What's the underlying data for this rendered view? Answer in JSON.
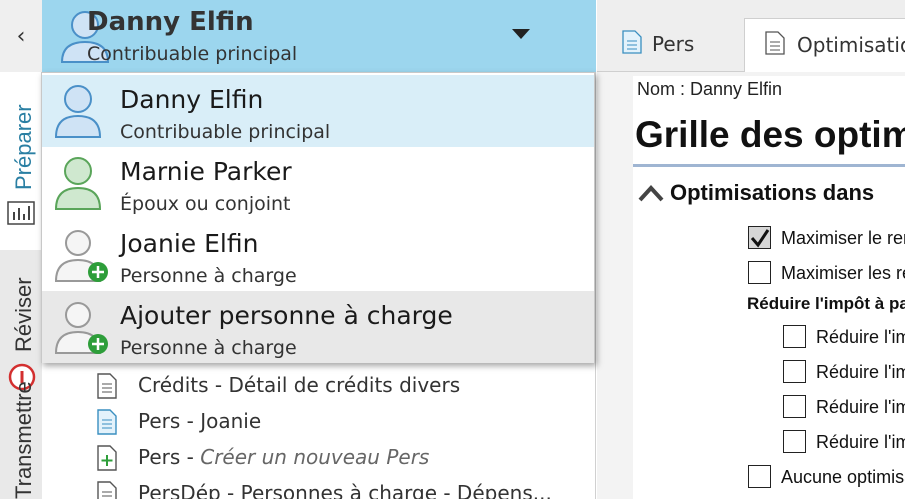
{
  "rail": {
    "collapse_glyph": "‹",
    "tabs": [
      {
        "label": "Préparer",
        "icon": "chart-icon"
      },
      {
        "label": "Réviser",
        "icon": "error-icon"
      },
      {
        "label": "Transmettre"
      }
    ]
  },
  "header": {
    "name": "Danny Elfin",
    "role": "Contribuable principal",
    "icon": "chevron-down-icon"
  },
  "dropdown": {
    "items": [
      {
        "name": "Danny Elfin",
        "role": "Contribuable principal",
        "icon": "person-blue-icon"
      },
      {
        "name": "Marnie Parker",
        "role": "Époux ou conjoint",
        "icon": "person-green-icon"
      },
      {
        "name": "Joanie Elfin",
        "role": "Personne à charge",
        "icon": "person-add-icon"
      },
      {
        "name": "Ajouter personne à charge",
        "role": "Personne à charge",
        "icon": "person-add-icon"
      }
    ]
  },
  "files": [
    {
      "prefix": "Crédits - Détail de crédits divers",
      "suffix": "",
      "icon": "document-icon"
    },
    {
      "prefix": "Pers - Joanie",
      "suffix": "",
      "icon": "document-blue-icon"
    },
    {
      "prefix": "Pers - ",
      "suffix": "Créer un nouveau Pers",
      "icon": "document-add-icon"
    },
    {
      "prefix": "PersDép - Personnes à charge - Dépens...",
      "suffix": "",
      "icon": "document-icon"
    }
  ],
  "tabs": [
    {
      "label": "Pers",
      "icon": "document-blue-icon"
    },
    {
      "label": "Optimisation",
      "icon": "document-icon"
    }
  ],
  "form": {
    "nom": "Nom : Danny Elfin",
    "title": "Grille des optimisations",
    "section": "Optimisations dans",
    "options": [
      {
        "label": "Maximiser le remboursement",
        "checked": true
      },
      {
        "label": "Maximiser les remboursements",
        "checked": false
      }
    ],
    "reduce_heading": "Réduire l'impôt à payer",
    "reduce_options": [
      {
        "label": "Réduire l'impôt",
        "checked": false
      },
      {
        "label": "Réduire l'impôt",
        "checked": false
      },
      {
        "label": "Réduire l'impôt",
        "checked": false
      },
      {
        "label": "Réduire l'impôt",
        "checked": false
      }
    ],
    "none_option": {
      "label": "Aucune optimisation",
      "checked": false
    }
  },
  "colors": {
    "header_bg": "#9cd6ee",
    "selected_bg": "#d9eef8",
    "hover_bg": "#e8e8e8",
    "accent": "#2a7fa3",
    "person_blue": "#4a90c8",
    "person_green": "#5aa55a",
    "add_green": "#2e9e3a",
    "error_red": "#d32f2f"
  }
}
